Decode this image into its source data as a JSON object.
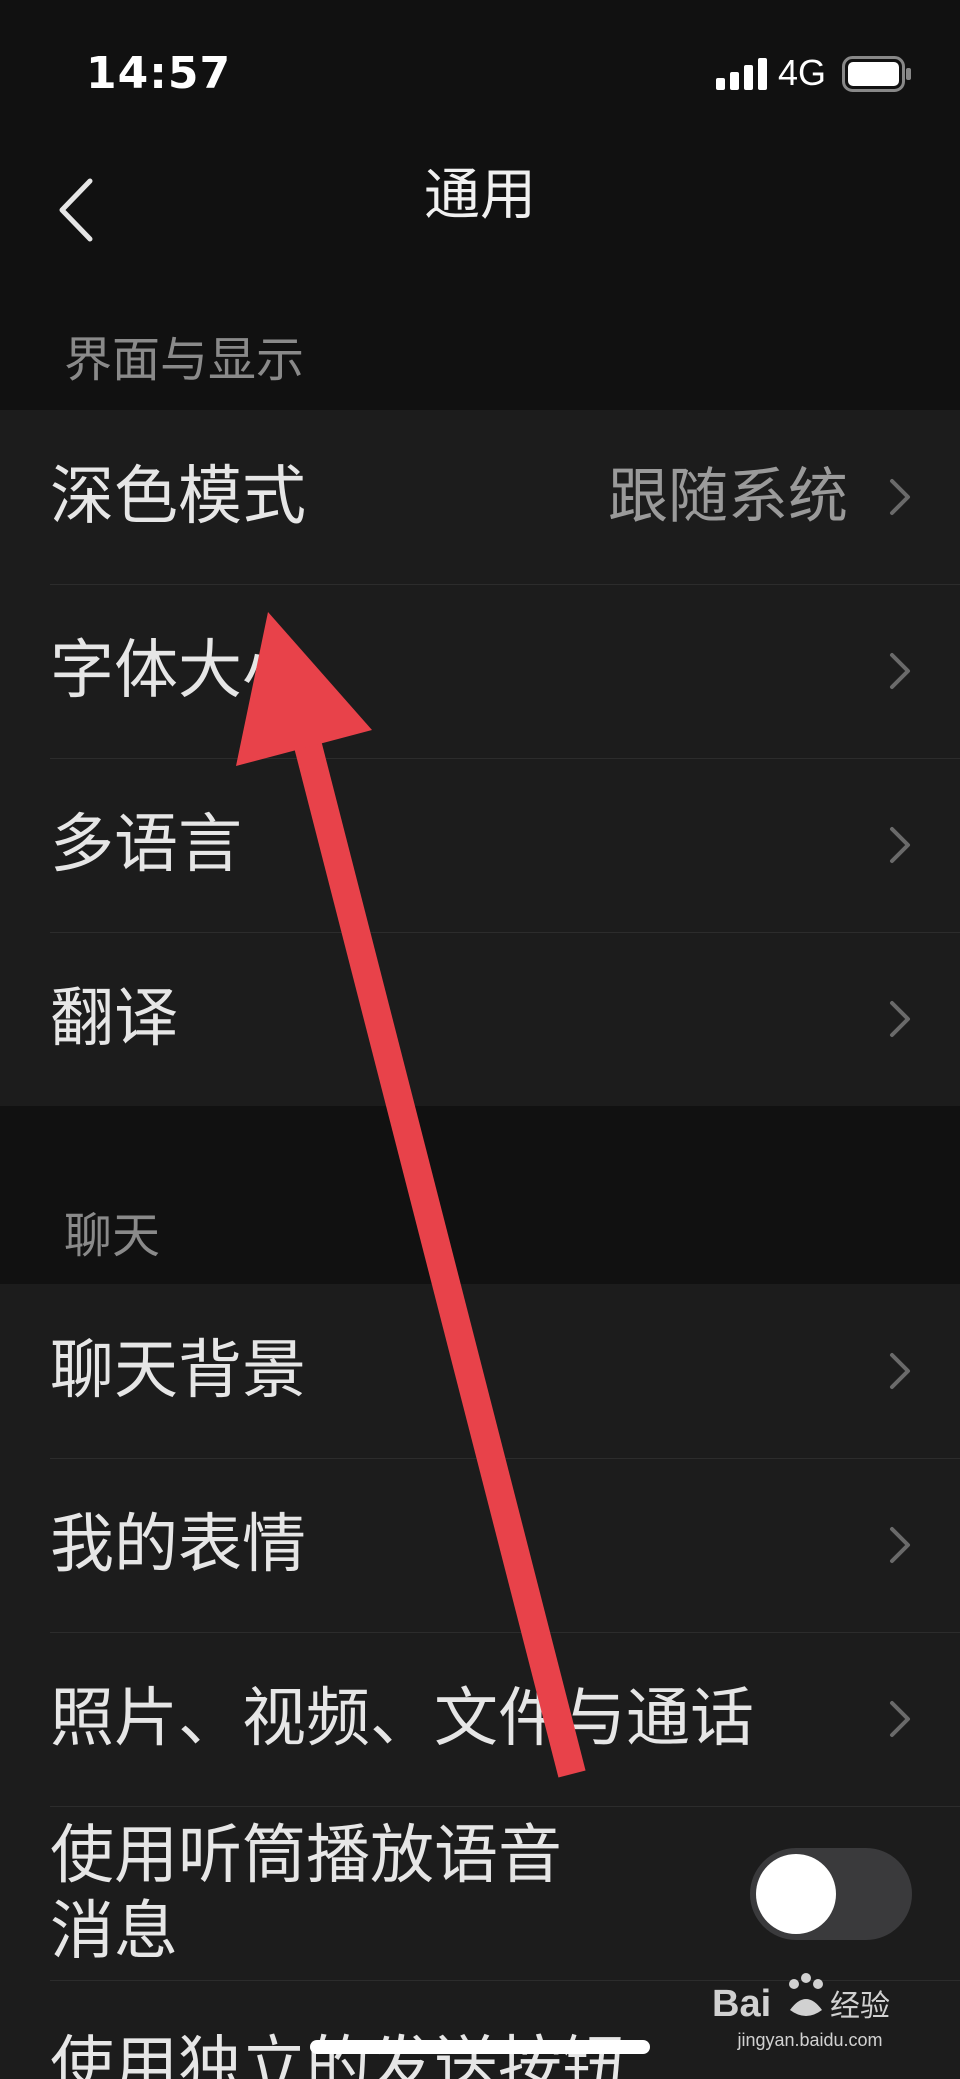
{
  "status_bar": {
    "time": "14:57",
    "network": "4G",
    "icons": [
      "signal-icon",
      "battery-icon"
    ]
  },
  "nav": {
    "title": "通用",
    "back_icon": "chevron-left-icon"
  },
  "sections": [
    {
      "header": "界面与显示",
      "items": [
        {
          "label": "深色模式",
          "value": "跟随系统"
        },
        {
          "label": "字体大小",
          "value": ""
        },
        {
          "label": "多语言",
          "value": ""
        },
        {
          "label": "翻译",
          "value": ""
        }
      ]
    },
    {
      "header": "聊天",
      "items": [
        {
          "label": "聊天背景"
        },
        {
          "label": "我的表情"
        },
        {
          "label": "照片、视频、文件与通话"
        },
        {
          "label": "使用听筒播放语音消息",
          "toggle": false
        },
        {
          "label": "使用独立的发送按钮"
        }
      ]
    }
  ],
  "annotation": {
    "color": "#e8424a"
  },
  "watermark": {
    "logo_text": "Bai du 经验",
    "url": "jingyan.baidu.com"
  }
}
